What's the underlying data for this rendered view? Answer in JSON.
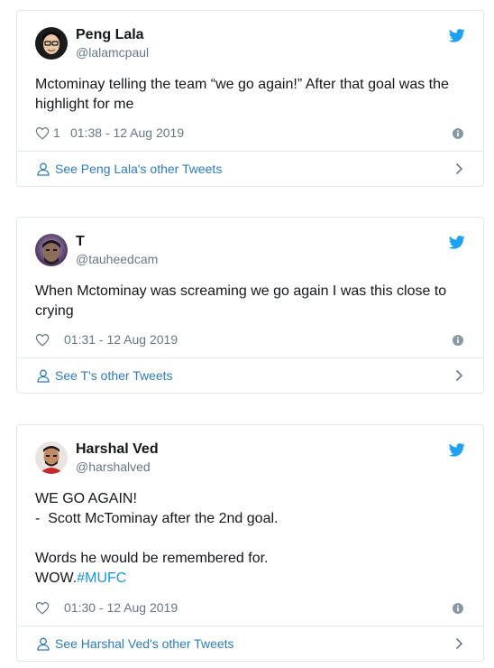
{
  "colors": {
    "accent": "#1da1f2",
    "link": "#2b7bb9",
    "muted": "#657786",
    "border": "#e1e8ed"
  },
  "tweets": [
    {
      "name": "Peng Lala",
      "handle": "@lalamcpaul",
      "text_lines": [
        "Mctominay telling the team “we go again!” After that goal was the",
        "highlight for me"
      ],
      "likes": "1",
      "time": "01:38 - 12 Aug 2019",
      "footer_label": "See Peng Lala's other Tweets",
      "icons": [
        "avatar",
        "twitter-bird-icon",
        "heart-icon",
        "info-icon",
        "person-icon",
        "chevron-right-icon"
      ]
    },
    {
      "name": "T",
      "handle": "@tauheedcam",
      "text_lines": [
        "When Mctominay was screaming we go again I was this close to",
        "crying"
      ],
      "likes": "",
      "time": "01:31 - 12 Aug 2019",
      "footer_label": "See T's other Tweets"
    },
    {
      "name": "Harshal Ved",
      "handle": "@harshalved",
      "text_lines": [
        "WE GO AGAIN!",
        "-  Scott McTominay after the 2nd goal.",
        "",
        "Words he would be remembered for."
      ],
      "last_line_text": "WOW.",
      "hashtag": "#MUFC",
      "likes": "",
      "time": "01:30 - 12 Aug 2019",
      "footer_label": "See Harshal Ved's other Tweets"
    }
  ]
}
